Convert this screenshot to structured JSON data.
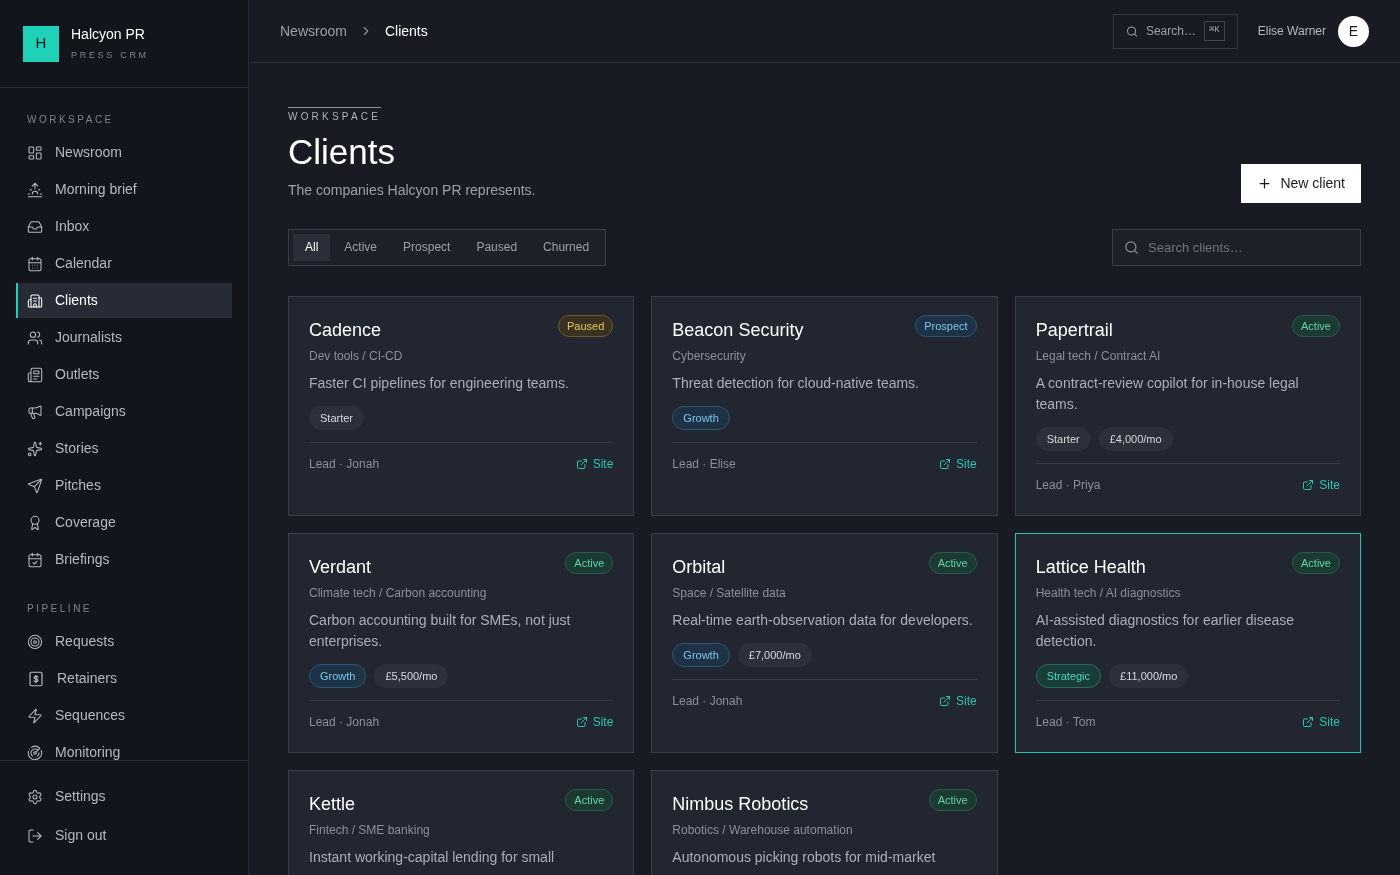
{
  "sidebar": {
    "brand": {
      "logo": "H",
      "name": "Halcyon PR",
      "tagline": "PRESS CRM"
    },
    "sections": [
      {
        "heading": "WORKSPACE",
        "items": [
          {
            "label": "Newsroom",
            "selected": false
          },
          {
            "label": "Morning brief",
            "selected": false
          },
          {
            "label": "Inbox",
            "selected": false
          },
          {
            "label": "Calendar",
            "selected": false
          },
          {
            "label": "Clients",
            "selected": true
          },
          {
            "label": "Journalists",
            "selected": false
          },
          {
            "label": "Outlets",
            "selected": false
          },
          {
            "label": "Campaigns",
            "selected": false
          },
          {
            "label": "Stories",
            "selected": false
          },
          {
            "label": "Pitches",
            "selected": false
          },
          {
            "label": "Coverage",
            "selected": false
          },
          {
            "label": "Briefings",
            "selected": false
          }
        ]
      },
      {
        "heading": "PIPELINE",
        "items": [
          {
            "label": "Requests",
            "selected": false
          },
          {
            "label": "Retainers",
            "selected": false
          },
          {
            "label": "Sequences",
            "selected": false
          },
          {
            "label": "Monitoring",
            "selected": false
          }
        ]
      }
    ],
    "footer_items": [
      {
        "label": "Settings"
      },
      {
        "label": "Sign out"
      }
    ]
  },
  "header": {
    "breadcrumb": [
      {
        "label": "Newsroom"
      },
      {
        "label": "Clients"
      }
    ],
    "search": {
      "placeholder": "Search…",
      "shortcut": "⌘K"
    },
    "user": {
      "name": "Elise Warner",
      "initial": "E"
    }
  },
  "page": {
    "eyebrow": "WORKSPACE",
    "title": "Clients",
    "subtitle": "The companies Halcyon PR represents.",
    "new_button": "New client",
    "filters": [
      {
        "label": "All",
        "selected": true
      },
      {
        "label": "Active",
        "selected": false
      },
      {
        "label": "Prospect",
        "selected": false
      },
      {
        "label": "Paused",
        "selected": false
      },
      {
        "label": "Churned",
        "selected": false
      }
    ],
    "search": {
      "placeholder": "Search clients…"
    }
  },
  "clients": [
    {
      "name": "Cadence",
      "category": "Dev tools / CI-CD",
      "status": {
        "label": "Paused",
        "kind": "paused"
      },
      "description": "Faster CI pipelines for engineering teams.",
      "tags": [
        {
          "label": "Starter",
          "kind": "starter"
        }
      ],
      "lead": "Lead · Jonah",
      "link": "Site",
      "selected": false
    },
    {
      "name": "Beacon Security",
      "category": "Cybersecurity",
      "status": {
        "label": "Prospect",
        "kind": "prospect"
      },
      "description": "Threat detection for cloud-native teams.",
      "tags": [
        {
          "label": "Growth",
          "kind": "growth"
        }
      ],
      "lead": "Lead · Elise",
      "link": "Site",
      "selected": false
    },
    {
      "name": "Papertrail",
      "category": "Legal tech / Contract AI",
      "status": {
        "label": "Active",
        "kind": "active"
      },
      "description": "A contract-review copilot for in-house legal teams.",
      "tags": [
        {
          "label": "Starter",
          "kind": "starter"
        },
        {
          "label": "£4,000/mo",
          "kind": "price"
        }
      ],
      "lead": "Lead · Priya",
      "link": "Site",
      "selected": false
    },
    {
      "name": "Verdant",
      "category": "Climate tech / Carbon accounting",
      "status": {
        "label": "Active",
        "kind": "active"
      },
      "description": "Carbon accounting built for SMEs, not just enterprises.",
      "tags": [
        {
          "label": "Growth",
          "kind": "growth"
        },
        {
          "label": "£5,500/mo",
          "kind": "price"
        }
      ],
      "lead": "Lead · Jonah",
      "link": "Site",
      "selected": false
    },
    {
      "name": "Orbital",
      "category": "Space / Satellite data",
      "status": {
        "label": "Active",
        "kind": "active"
      },
      "description": "Real-time earth-observation data for developers.",
      "tags": [
        {
          "label": "Growth",
          "kind": "growth"
        },
        {
          "label": "£7,000/mo",
          "kind": "price"
        }
      ],
      "lead": "Lead · Jonah",
      "link": "Site",
      "selected": false
    },
    {
      "name": "Lattice Health",
      "category": "Health tech / AI diagnostics",
      "status": {
        "label": "Active",
        "kind": "active"
      },
      "description": "AI-assisted diagnostics for earlier disease detection.",
      "tags": [
        {
          "label": "Strategic",
          "kind": "strategic"
        },
        {
          "label": "£11,000/mo",
          "kind": "price"
        }
      ],
      "lead": "Lead · Tom",
      "link": "Site",
      "selected": true
    },
    {
      "name": "Kettle",
      "category": "Fintech / SME banking",
      "status": {
        "label": "Active",
        "kind": "active"
      },
      "description": "Instant working-capital lending for small",
      "selected": false
    },
    {
      "name": "Nimbus Robotics",
      "category": "Robotics / Warehouse automation",
      "status": {
        "label": "Active",
        "kind": "active"
      },
      "description": "Autonomous picking robots for mid-market",
      "selected": false
    }
  ]
}
